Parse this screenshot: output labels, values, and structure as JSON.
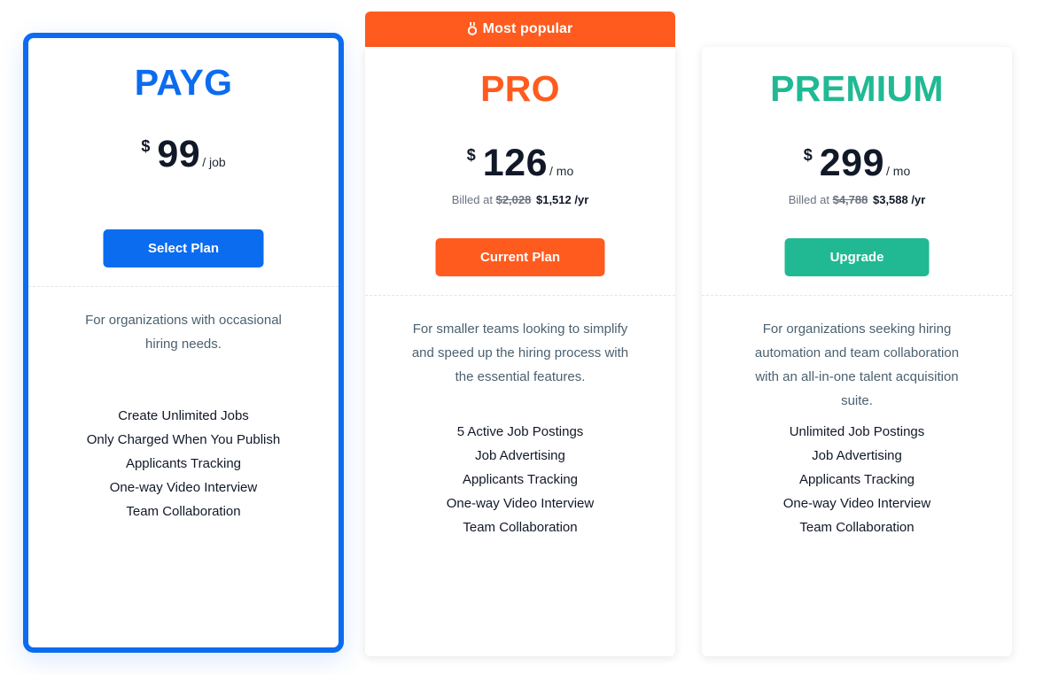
{
  "ribbon": {
    "icon": "medal-icon",
    "label": "Most popular",
    "color": "#ff5b1f"
  },
  "plans": [
    {
      "name": "PAYG",
      "color": "#0b6cf0",
      "currency": "$",
      "price": "99",
      "period": "/ job",
      "button_label": "Select Plan",
      "selected": true,
      "description": "For organizations with occasional hiring needs.",
      "features": [
        "Create Unlimited Jobs",
        "Only Charged When You Publish",
        "Applicants Tracking",
        "One-way Video Interview",
        "Team Collaboration"
      ]
    },
    {
      "name": "PRO",
      "color": "#ff5b1f",
      "currency": "$",
      "price": "126",
      "period": "/ mo",
      "billed_prefix": "Billed at",
      "billed_old": "$2,028",
      "billed_new": "$1,512 /yr",
      "button_label": "Current Plan",
      "description": "For smaller teams looking to simplify and speed up the hiring process with the essential features.",
      "features": [
        "5 Active Job Postings",
        "Job Advertising",
        "Applicants Tracking",
        "One-way Video Interview",
        "Team Collaboration"
      ]
    },
    {
      "name": "PREMIUM",
      "color": "#20b993",
      "currency": "$",
      "price": "299",
      "period": "/ mo",
      "billed_prefix": "Billed at",
      "billed_old": "$4,788",
      "billed_new": "$3,588 /yr",
      "button_label": "Upgrade",
      "description": "For organizations seeking hiring automation and team collaboration with an all-in-one talent acquisition suite.",
      "features": [
        "Unlimited Job Postings",
        "Job Advertising",
        "Applicants Tracking",
        "One-way Video Interview",
        "Team Collaboration"
      ]
    }
  ]
}
